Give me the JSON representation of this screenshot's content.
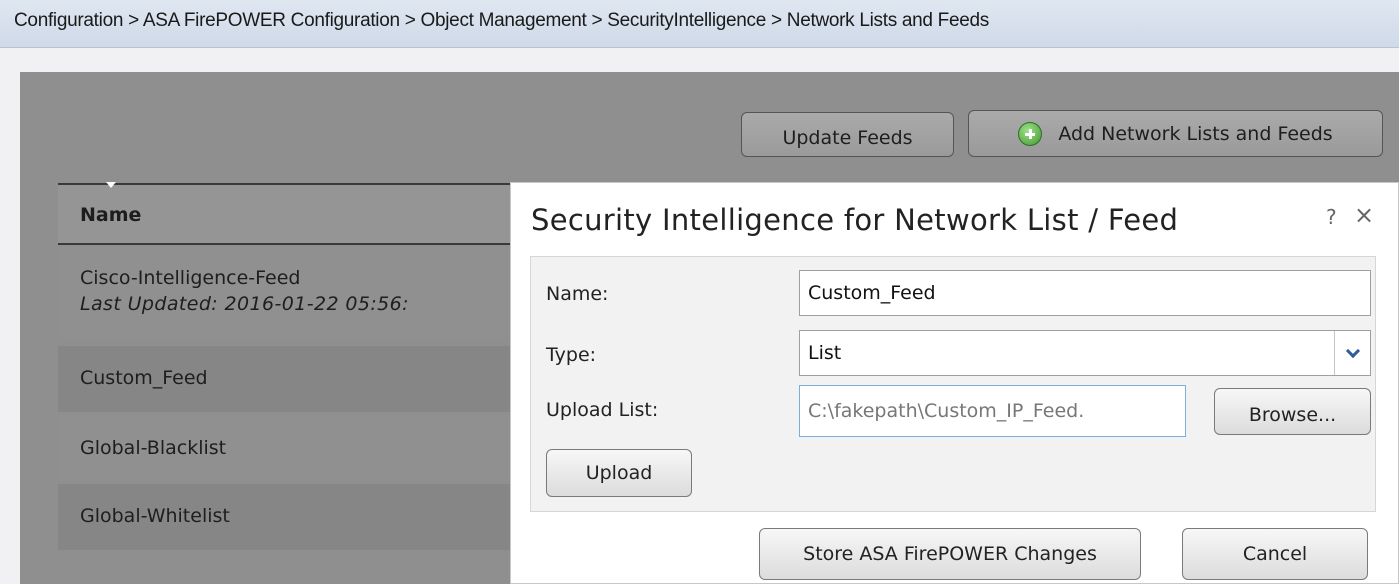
{
  "breadcrumb": "Configuration > ASA FirePOWER Configuration > Object Management > SecurityIntelligence > Network Lists and Feeds",
  "toolbar": {
    "update_feeds": "Update Feeds",
    "add_lists": "Add Network Lists and Feeds",
    "add_icon": "plus-circle-icon"
  },
  "table": {
    "header_name": "Name",
    "rows": [
      {
        "name": "Cisco-Intelligence-Feed",
        "sub": "Last Updated: 2016-01-22 05:56:"
      },
      {
        "name": "Custom_Feed"
      },
      {
        "name": "Global-Blacklist"
      },
      {
        "name": "Global-Whitelist"
      }
    ]
  },
  "dialog": {
    "title": "Security Intelligence for Network List / Feed",
    "help": "?",
    "close": "×",
    "name_label": "Name:",
    "name_value": "Custom_Feed",
    "type_label": "Type:",
    "type_value": "List",
    "upload_label": "Upload List:",
    "upload_value": "C:\\fakepath\\Custom_IP_Feed.",
    "browse": "Browse...",
    "upload_button": "Upload",
    "store": "Store ASA FirePOWER Changes",
    "cancel": "Cancel"
  }
}
